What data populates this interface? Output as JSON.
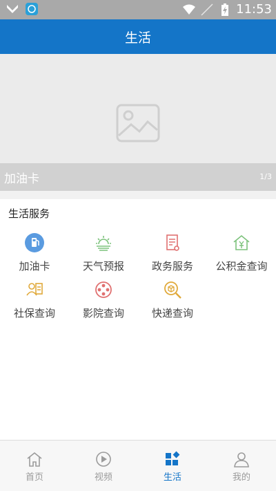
{
  "status_bar": {
    "time": "11:53",
    "icons": [
      "notification-icon",
      "app-icon",
      "wifi-icon",
      "no-signal-icon",
      "battery-charging-icon"
    ]
  },
  "app_bar": {
    "title": "生活"
  },
  "banner": {
    "caption": "加油卡",
    "counter": "1/3",
    "image": "image-placeholder-icon"
  },
  "services": {
    "title": "生活服务",
    "items": [
      {
        "label": "加油卡",
        "icon": "fuel-icon",
        "color": "#5a9be0"
      },
      {
        "label": "天气预报",
        "icon": "weather-icon",
        "color": "#7cc27b"
      },
      {
        "label": "政务服务",
        "icon": "document-icon",
        "color": "#e07070"
      },
      {
        "label": "公积金查询",
        "icon": "housing-fund-icon",
        "color": "#7cc27b"
      },
      {
        "label": "社保查询",
        "icon": "social-security-icon",
        "color": "#e0a93a"
      },
      {
        "label": "影院查询",
        "icon": "cinema-icon",
        "color": "#e07070"
      },
      {
        "label": "快递查询",
        "icon": "express-icon",
        "color": "#e0a93a"
      }
    ]
  },
  "bottom_nav": {
    "items": [
      {
        "label": "首页",
        "icon": "home-icon",
        "active": false
      },
      {
        "label": "视频",
        "icon": "video-icon",
        "active": false
      },
      {
        "label": "生活",
        "icon": "life-icon",
        "active": true
      },
      {
        "label": "我的",
        "icon": "profile-icon",
        "active": false
      }
    ],
    "active_color": "#1475c8",
    "inactive_color": "#9b9b9b"
  }
}
